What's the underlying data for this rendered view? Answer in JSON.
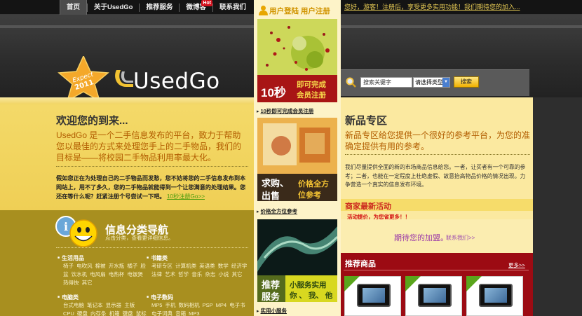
{
  "topnav": {
    "items": [
      {
        "label": "首页",
        "active": true
      },
      {
        "label": "关于UsedGo"
      },
      {
        "label": "推荐服务"
      },
      {
        "label": "微博客",
        "badge": "Hot"
      },
      {
        "label": "联系我们"
      }
    ],
    "welcome": "您好，游客！注册后，享受更多实用功能！我们期待您的加入..."
  },
  "logo": {
    "badge_line1": "Expect",
    "badge_line2": "2011",
    "name": "UsedGo"
  },
  "search": {
    "placeholder": "搜索关键字",
    "type_select": "请选择类型",
    "button": "搜索"
  },
  "welcome_section": {
    "title": "欢迎您的到来...",
    "description": "UsedGo 是一个二手信息发布的平台，致力于帮助您以最佳的方式来处理您手上的二手物品，我们的目标是——将校园二手物品利用率最大化。",
    "small_text": "假如您正在为处理自己的二手物品而发愁，您不妨将您的二手信息发布到本网站上，用不了多久，您的二手物品就能得到一个让您满意的处理结果。您还在等什么呢？赶紧注册个号尝试一下吧。",
    "register_link": "10秒注册Go>>"
  },
  "category_nav": {
    "title": "信息分类导航",
    "subtitle": "点击分类，查看更详细信息。",
    "categories": [
      {
        "name": "生活用品",
        "items": "椅子 电吹风 棉被 开水瓶 橘子 脸盆 饮水机 电风扇 电热杯 电饭煲 热得快 其它"
      },
      {
        "name": "书籍类",
        "items": "考研专区 计算机类 英语类 数学 经济学 法律 艺术 哲学 音乐 杂志 小说 其它"
      },
      {
        "name": "电脑类",
        "items": "台式电脑 笔记本 显示器 主板 CPU 硬盘 内存条 机箱 键盘 鼠标"
      },
      {
        "name": "电子数码",
        "items": "MP5 手机 数码相机 PSP MP4 电子书 电子词典 音箱 MP3"
      }
    ]
  },
  "middle": {
    "header": "用户登陆 用户注册",
    "promo1": {
      "big": "10秒",
      "line1": "即可完成",
      "line2": "会员注册"
    },
    "link1": "10秒即可完成会员注册",
    "promo2": {
      "left1": "求购、",
      "left2": "出售",
      "right1": "价格全方",
      "right2": "位参考"
    },
    "link2": "价格全方位参考",
    "promo3": {
      "left1": "推荐",
      "left2": "服务",
      "right1": "小服务实用",
      "right2": "你 、 我、 他"
    },
    "link3": "实用小服务"
  },
  "new_section": {
    "title": "新品专区",
    "description": "新品专区给您提供一个很好的参考平台，为您的准确定提供有用的参考。",
    "small_bold": "我们尽量提供全面的新的市场商品信息给您。一者，让买者有一个可靠的参考；二者，也能在一定程度上杜绝虚假、故意抬高物品价格的情况出现。力争营造一个真实的信息发布环境。"
  },
  "shop_section": {
    "title": "商家最新活动",
    "sub": "活动提价，为您省更多！！",
    "waiting": "期待您的加盟。",
    "contact": "联系我们>>"
  },
  "recommend": {
    "title": "推荐商品",
    "more": "更多>>"
  },
  "colors": {
    "yellow": "#f1d462",
    "olive": "#a88f1f",
    "accent_red": "#9c0b13",
    "green_link": "#4a9c0c"
  }
}
